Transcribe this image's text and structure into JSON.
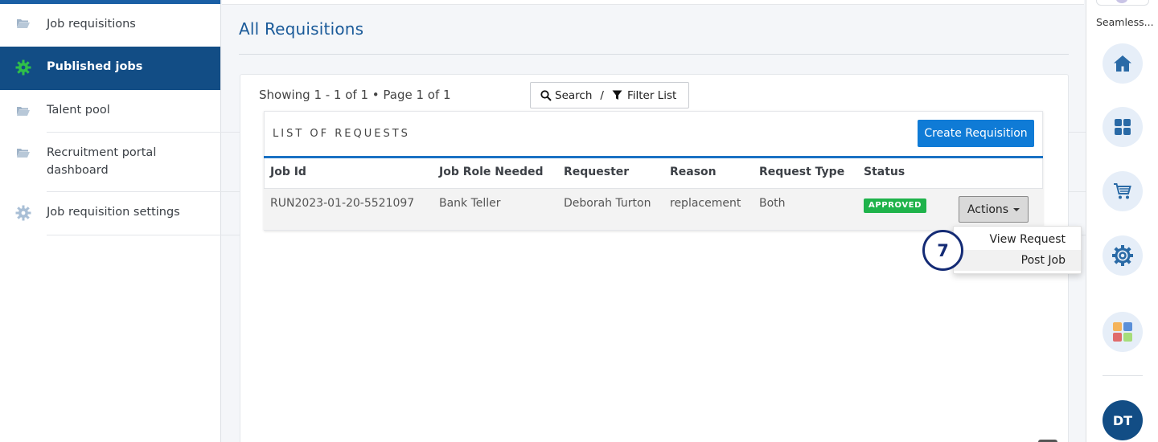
{
  "sidebar": {
    "items": [
      {
        "label": "Job requisitions",
        "icon": "folder-open-icon"
      },
      {
        "label": "Published jobs",
        "icon": "gear-icon",
        "active": true
      },
      {
        "label": "Talent pool",
        "icon": "folder-open-icon"
      },
      {
        "label": "Recruitment portal dashboard",
        "icon": "folder-open-icon"
      },
      {
        "label": "Job requisition settings",
        "icon": "gear-icon"
      }
    ]
  },
  "main": {
    "title": "All Requisitions",
    "showing": "Showing 1 - 1 of 1 • Page 1 of 1",
    "search_label": "Search",
    "separator": "/",
    "filter_label": "Filter List"
  },
  "list": {
    "title": "LIST OF REQUESTS",
    "create_label": "Create Requisition",
    "columns": [
      "Job Id",
      "Job Role Needed",
      "Requester",
      "Reason",
      "Request Type",
      "Status"
    ],
    "rows": [
      {
        "job_id": "RUN2023-01-20-5521097",
        "role": "Bank Teller",
        "requester": "Deborah Turton",
        "reason": "replacement",
        "type": "Both",
        "status": "APPROVED",
        "actions_label": "Actions"
      }
    ]
  },
  "dropdown": {
    "items": [
      "View Request",
      "Post Job"
    ]
  },
  "step_marker": "7",
  "rail": {
    "label": "Seamless...",
    "buttons": [
      "home-icon",
      "grid-icon",
      "cart-icon",
      "settings-gear-icon",
      "apps-icon"
    ],
    "avatar_initials": "DT"
  },
  "colors": {
    "primary": "#124d85",
    "accent": "#0f7bd6",
    "approved": "#1fb34b",
    "title": "#1a5a99"
  }
}
